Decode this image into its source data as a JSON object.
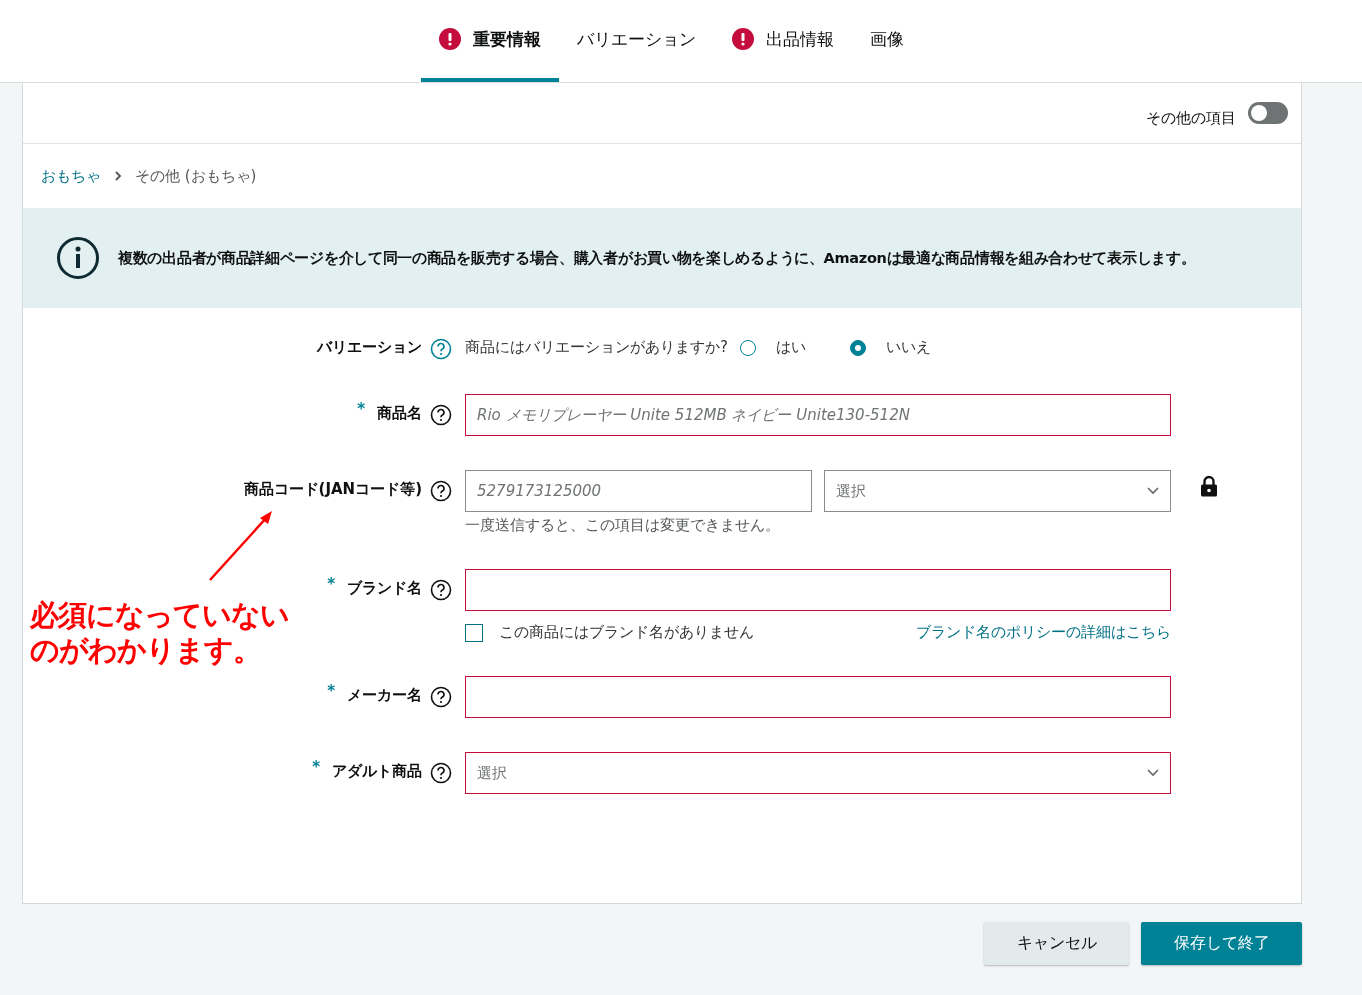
{
  "tabs": [
    {
      "label": "重要情報",
      "alert": true,
      "selected": true
    },
    {
      "label": "バリエーション",
      "alert": false,
      "selected": false
    },
    {
      "label": "出品情報",
      "alert": true,
      "selected": false
    },
    {
      "label": "画像",
      "alert": false,
      "selected": false
    }
  ],
  "toggle": {
    "label": "その他の項目",
    "on": false
  },
  "breadcrumb": [
    {
      "label": "おもちゃ",
      "kind": "link"
    },
    {
      "label": "その他 (おもちゃ)",
      "kind": "current"
    }
  ],
  "info": "複数の出品者が商品詳細ページを介して同一の商品を販売する場合、購入者がお買い物を楽しめるように、Amazonは最適な商品情報を組み合わせて表示します。",
  "fields": [
    {
      "kind": "radio",
      "label": "バリエーション",
      "question": "商品にはバリエーションがありますか?",
      "options": [
        {
          "label": "はい",
          "selected": false
        },
        {
          "label": "いいえ",
          "selected": true
        }
      ]
    },
    {
      "kind": "text",
      "label": "商品名",
      "asterisk": "*",
      "invalid": true,
      "placeholder": "Rio メモリプレーヤー Unite 512MB ネイビー Unite130-512N"
    },
    {
      "kind": "code",
      "label": "商品コード(JANコード等)",
      "invalid": false,
      "placeholder": "5279173125000",
      "select": "選択",
      "note": "一度送信すると、この項目は変更できません。",
      "locked": true
    },
    {
      "kind": "text",
      "label": "ブランド名",
      "asterisk": "*",
      "invalid": true,
      "checkbox": {
        "label": "この商品にはブランド名がありません",
        "checked": false
      },
      "link": "ブランド名のポリシーの詳細はこちら"
    },
    {
      "kind": "text",
      "label": "メーカー名",
      "asterisk": "*",
      "invalid": true
    },
    {
      "kind": "select",
      "label": "アダルト商品",
      "asterisk": "*",
      "invalid": true,
      "placeholder": "選択"
    }
  ],
  "buttons": [
    {
      "label": "キャンセル",
      "kind": "secondary"
    },
    {
      "label": "保存して終了",
      "kind": "primary"
    }
  ],
  "annotation": {
    "lines": [
      "必須になっていない",
      "のがわかります。"
    ]
  }
}
